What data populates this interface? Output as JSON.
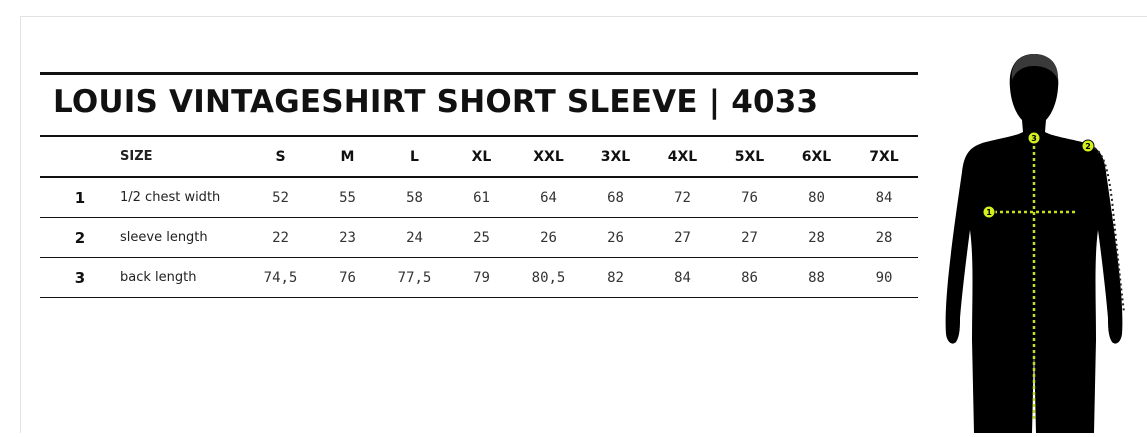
{
  "title": "LOUIS VINTAGESHIRT SHORT SLEEVE | 4033",
  "table": {
    "header": {
      "number": "",
      "label": "SIZE",
      "sizes": [
        "S",
        "M",
        "L",
        "XL",
        "XXL",
        "3XL",
        "4XL",
        "5XL",
        "6XL",
        "7XL"
      ]
    },
    "rows": [
      {
        "number": "1",
        "label": "1/2 chest width",
        "values": [
          "52",
          "55",
          "58",
          "61",
          "64",
          "68",
          "72",
          "76",
          "80",
          "84"
        ]
      },
      {
        "number": "2",
        "label": "sleeve length",
        "values": [
          "22",
          "23",
          "24",
          "25",
          "26",
          "26",
          "27",
          "27",
          "28",
          "28"
        ]
      },
      {
        "number": "3",
        "label": "back length",
        "values": [
          "74,5",
          "76",
          "77,5",
          "79",
          "80,5",
          "82",
          "84",
          "86",
          "88",
          "90"
        ]
      }
    ]
  },
  "figure": {
    "markers": [
      "1",
      "2",
      "3"
    ],
    "colors": {
      "silhouette": "#000000",
      "marker": "#d4ef1f",
      "measure_line": "#c6df1a"
    }
  }
}
